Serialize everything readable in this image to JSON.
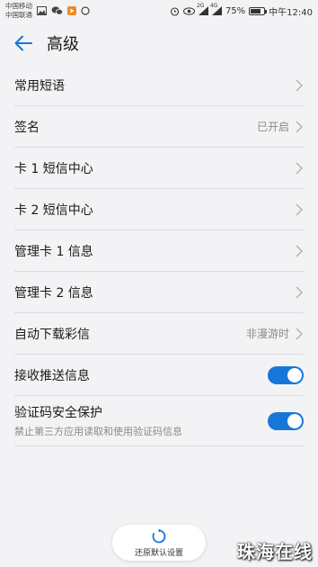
{
  "status_bar": {
    "carrier1": "中国移动",
    "carrier2": "中国联通",
    "battery": "75%",
    "battery_level": 0.75,
    "time": "中午12:40",
    "net1": "2G",
    "net2": "4G"
  },
  "header": {
    "title": "高级"
  },
  "rows": [
    {
      "label": "常用短语",
      "value": ""
    },
    {
      "label": "签名",
      "value": "已开启"
    },
    {
      "label": "卡 1 短信中心",
      "value": ""
    },
    {
      "label": "卡 2 短信中心",
      "value": ""
    },
    {
      "label": "管理卡 1 信息",
      "value": ""
    },
    {
      "label": "管理卡 2 信息",
      "value": ""
    },
    {
      "label": "自动下载彩信",
      "value": "非漫游时"
    },
    {
      "label": "接收推送信息",
      "toggle": true
    },
    {
      "label": "验证码安全保护",
      "sub": "禁止第三方应用读取和使用验证码信息",
      "toggle": true
    }
  ],
  "restore": {
    "label": "还原默认设置"
  },
  "watermark": "珠海在线",
  "colors": {
    "accent": "#1677d9",
    "background": "#f3f3f6"
  }
}
